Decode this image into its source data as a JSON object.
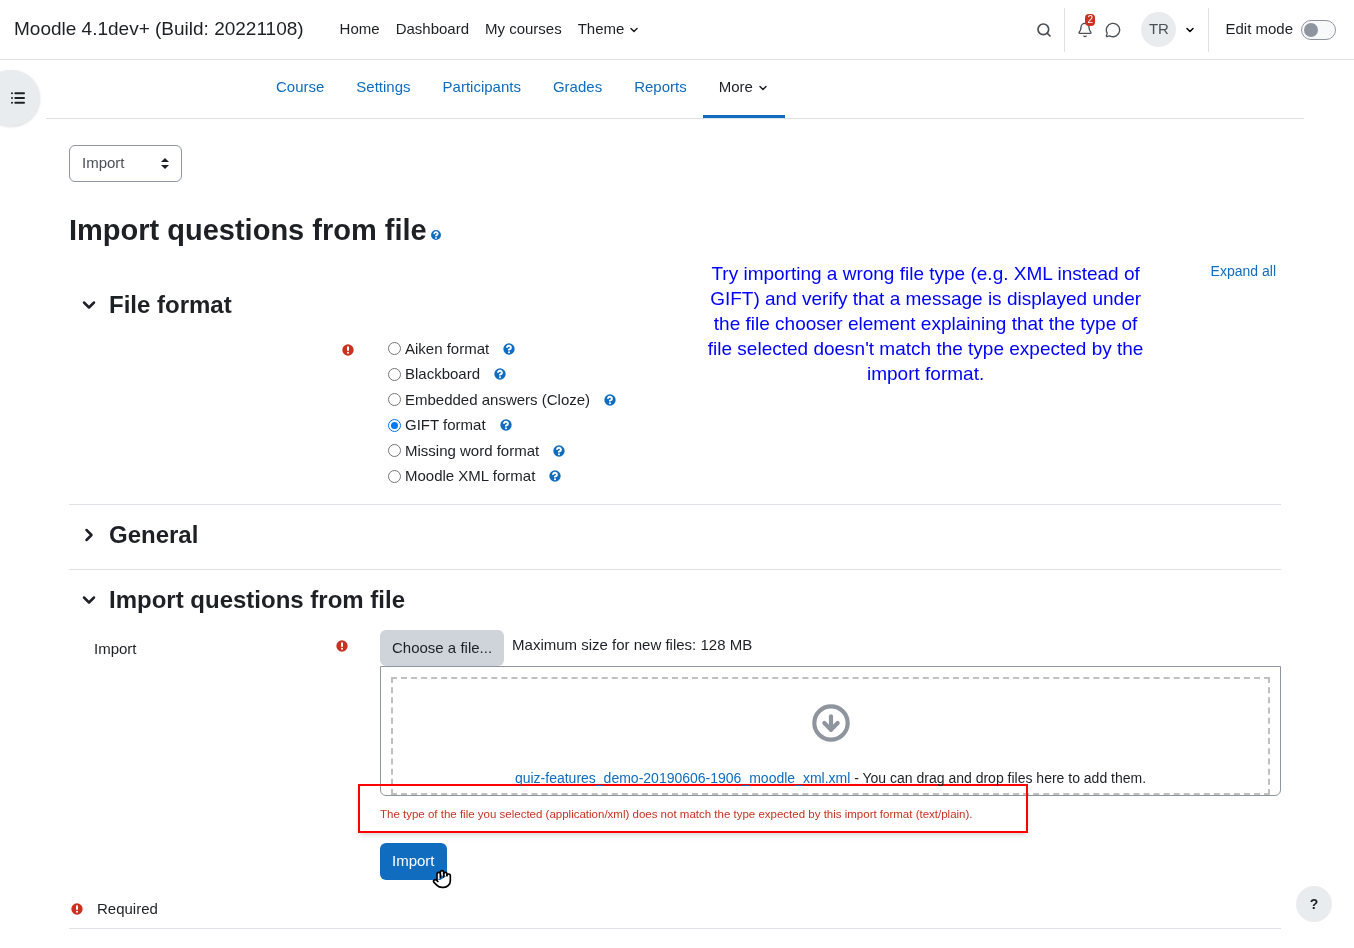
{
  "navbar": {
    "site_name": "Moodle 4.1dev+ (Build: 20221108)",
    "links": [
      {
        "label": "Home",
        "kind": "link"
      },
      {
        "label": "Dashboard",
        "kind": "link"
      },
      {
        "label": "My courses",
        "kind": "link"
      },
      {
        "label": "Theme",
        "kind": "dropdown"
      }
    ],
    "notification_count": "2",
    "avatar_initials": "TR",
    "edit_mode": {
      "label": "Edit mode",
      "on": false
    }
  },
  "secondary_nav": [
    {
      "label": "Course",
      "selected": false,
      "kind": "link"
    },
    {
      "label": "Settings",
      "selected": false,
      "kind": "link"
    },
    {
      "label": "Participants",
      "selected": false,
      "kind": "link"
    },
    {
      "label": "Grades",
      "selected": false,
      "kind": "link"
    },
    {
      "label": "Reports",
      "selected": false,
      "kind": "link"
    },
    {
      "label": "More",
      "selected": true,
      "kind": "dropdown"
    }
  ],
  "action_select": {
    "value": "Import"
  },
  "page_title": "Import questions from file",
  "annotation": "Try importing a wrong file type (e.g. XML instead of GIFT) and verify that a message is displayed under the file chooser element explaining that the type of file selected doesn't match the type expected by the import format.",
  "expand_all": "Expand all",
  "sections": [
    {
      "title": "File format",
      "expanded": true,
      "kind": "radio_group",
      "required": true,
      "options": [
        {
          "label": "Aiken format",
          "selected": false
        },
        {
          "label": "Blackboard",
          "selected": false
        },
        {
          "label": "Embedded answers (Cloze)",
          "selected": false
        },
        {
          "label": "GIFT format",
          "selected": true
        },
        {
          "label": "Missing word format",
          "selected": false
        },
        {
          "label": "Moodle XML format",
          "selected": false
        }
      ]
    },
    {
      "title": "General",
      "expanded": false
    },
    {
      "title": "Import questions from file",
      "expanded": true,
      "kind": "file_picker",
      "required": true,
      "label": "Import",
      "choose_button": "Choose a file...",
      "max_size": "Maximum size for new files: 128 MB",
      "file_link": "quiz-features_demo-20190606-1906_moodle_xml.xml",
      "drop_text": " - You can drag and drop files here to add them.",
      "error": "The type of the file you selected (application/xml) does not match the type expected by this import format (text/plain)."
    }
  ],
  "submit_button": "Import",
  "required_note": "Required",
  "help_button": "?"
}
